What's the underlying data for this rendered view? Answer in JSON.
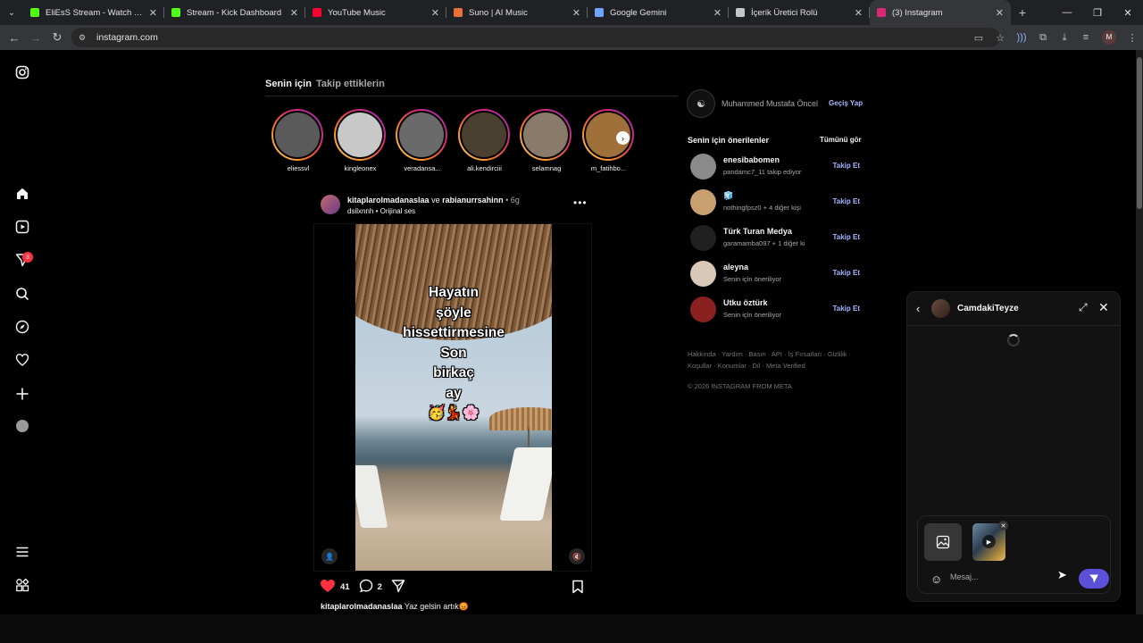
{
  "browser": {
    "tabs": [
      {
        "title": "EliEsS Stream - Watch Live o",
        "fav_color": "#53fc18",
        "active": false
      },
      {
        "title": "Stream - Kick Dashboard",
        "fav_color": "#53fc18",
        "active": false
      },
      {
        "title": "YouTube Music",
        "fav_color": "#ff0033",
        "active": false
      },
      {
        "title": "Suno | AI Music",
        "fav_color": "#e8733a",
        "active": false
      },
      {
        "title": "Google Gemini",
        "fav_color": "#6fa3ff",
        "active": false
      },
      {
        "title": "İçerik Üretici Rolü",
        "fav_color": "#c4c7c5",
        "active": false
      },
      {
        "title": "(3) Instagram",
        "fav_color": "#d62976",
        "active": true
      }
    ],
    "url": "instagram.com",
    "profile_initial": "M"
  },
  "feed": {
    "tab_for_you": "Senin için",
    "tab_following": "Takip ettiklerin",
    "notification_count": "3"
  },
  "stories": [
    {
      "name": "eliessvl",
      "color": "#5a5a5a"
    },
    {
      "name": "kingleonex",
      "color": "#c8c8c8"
    },
    {
      "name": "veradansa...",
      "color": "#6a6a6a"
    },
    {
      "name": "ali.kendirciii",
      "color": "#4a4030"
    },
    {
      "name": "selamnag",
      "color": "#8a7a6a"
    },
    {
      "name": "m_fatihbo...",
      "color": "#a0703a"
    }
  ],
  "post": {
    "user1": "kitaplarolmadanaslaa",
    "conj": "ve",
    "user2": "rabianurrsahinn",
    "time": "• 6g",
    "audio": "dsilxnnh • Orijinal ses",
    "overlay_text": "Hayatın\nşöyle\nhissettirmesine\nSon\nbirkaç\nay\n🥳💃🌸",
    "likes": "41",
    "comments": "2",
    "caption_user": "kitaplarolmadanaslaa",
    "caption_text": "Yaz gelsin artık😡"
  },
  "sidebar": {
    "me_name": "Muhammed Mustafa Öncel",
    "switch_label": "Geçiş Yap",
    "suggestions_title": "Senin için önerilenler",
    "see_all": "Tümünü gör",
    "suggestions": [
      {
        "name": "enesibabomen",
        "desc": "pandamc7_11 takip ediyor",
        "action": "Takip Et",
        "color": "#8a8a8a"
      },
      {
        "name": "🧊",
        "desc": "nothingfpsz0 + 4 diğer kişi",
        "action": "Takip Et",
        "color": "#c8a070"
      },
      {
        "name": "Türk Turan Medya",
        "desc": "garamamba097 + 1 diğer ki",
        "action": "Takip Et",
        "color": "#202020"
      },
      {
        "name": "aleyna",
        "desc": "Senin için öneriliyor",
        "action": "Takip Et",
        "color": "#d8c8b8"
      },
      {
        "name": "Utku öztürk",
        "desc": "Senin için öneriliyor",
        "action": "Takip Et",
        "color": "#8a2020"
      }
    ],
    "footer_links": "Hakkında · Yardım · Basın · API · İş Fırsatları · Gizlilik · Koşullar · Konumlar · Dil · Meta Verified",
    "copyright": "© 2026 INSTAGRAM FROM META"
  },
  "chat": {
    "name": "CamdakiTeyze",
    "placeholder": "Mesaj..."
  },
  "colors": {
    "accent_blue": "#a5b8ff",
    "send_button": "#5b51d8",
    "badge_red": "#ff3040",
    "like_red": "#ff3040"
  }
}
